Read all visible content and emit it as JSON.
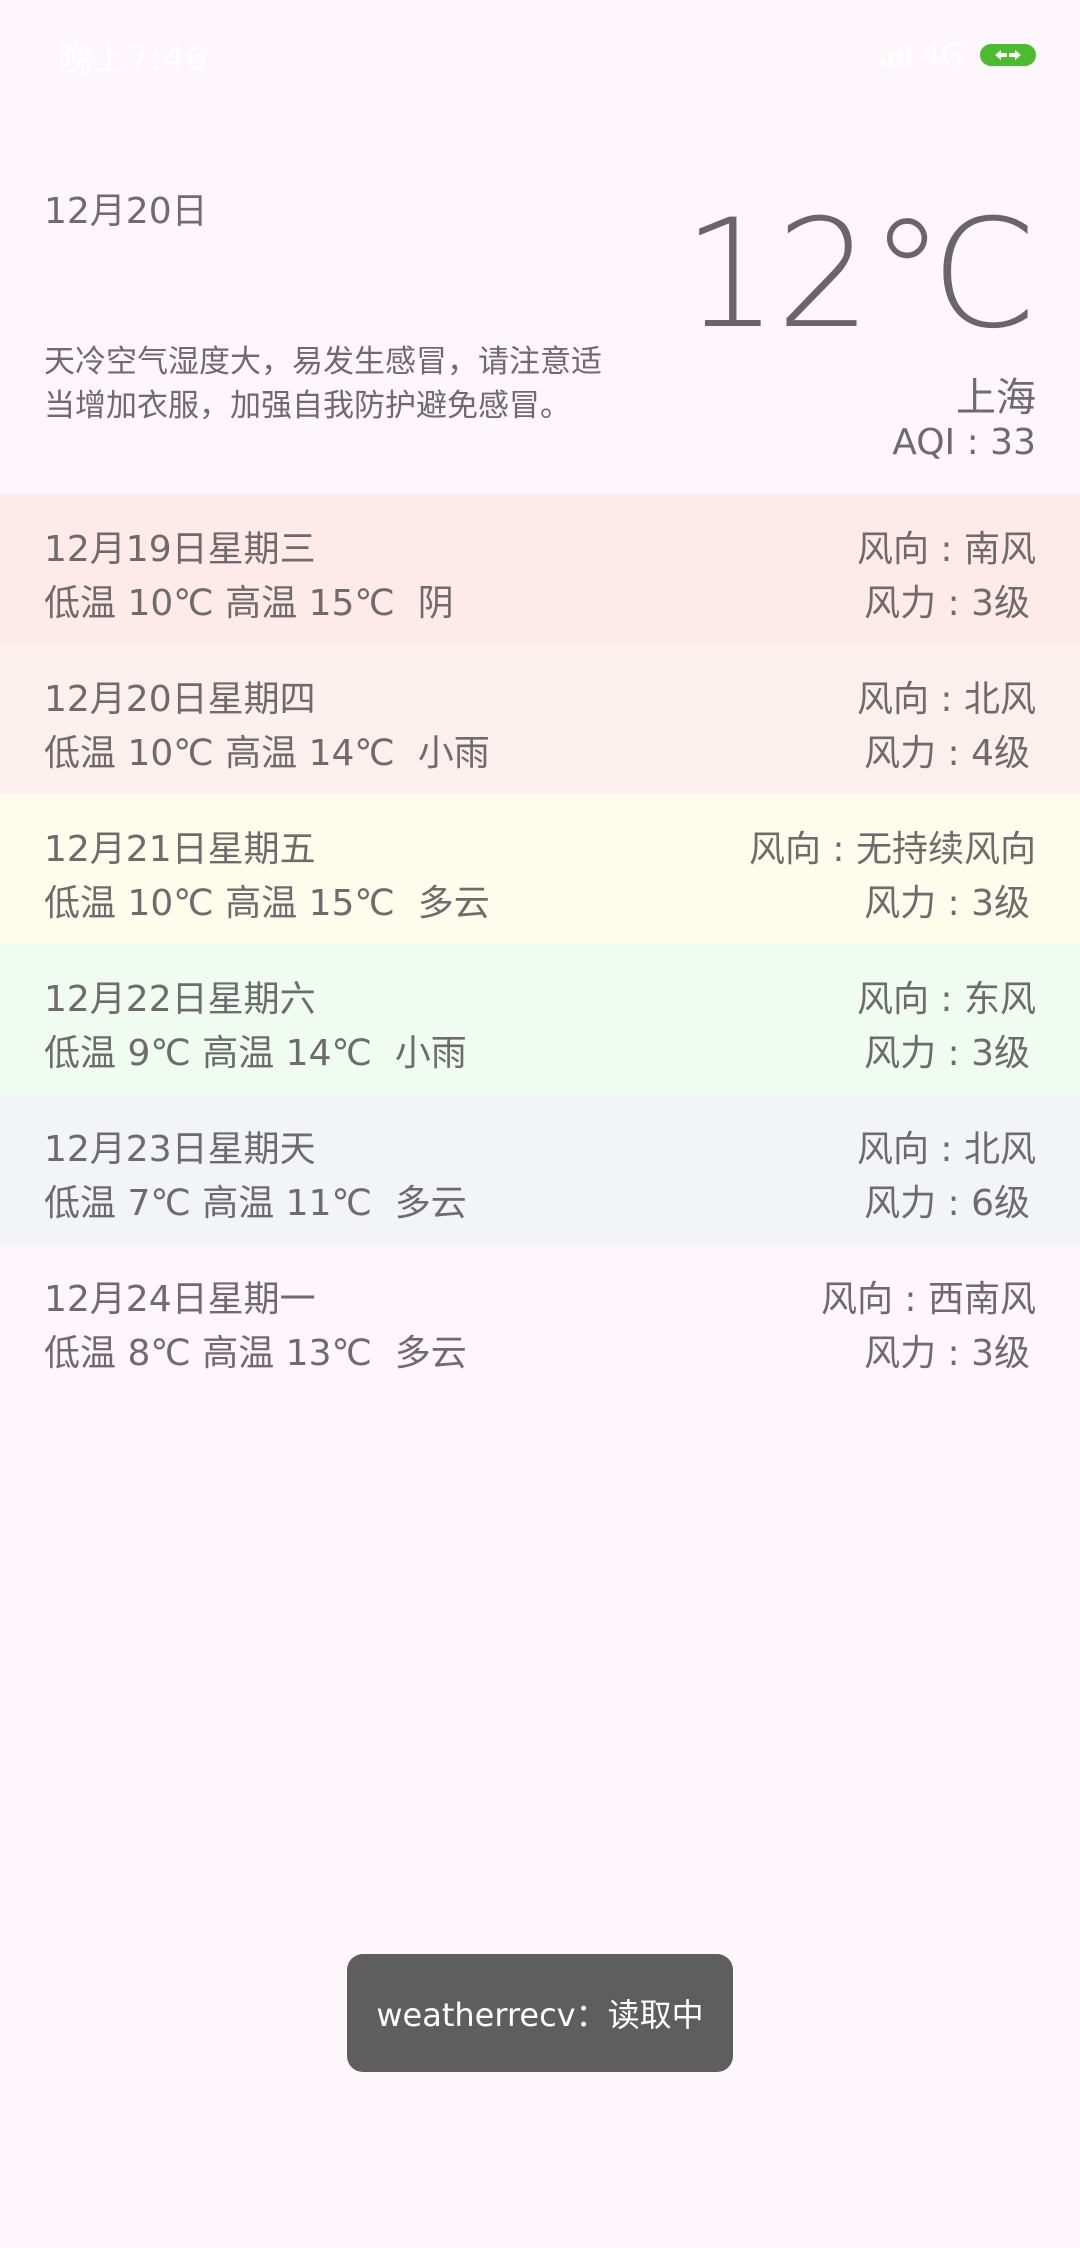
{
  "status_bar": {
    "time": "晚上7:46",
    "network": "4G",
    "battery_color": "#4cbc2e"
  },
  "header": {
    "date": "12月20日",
    "tip": "天冷空气湿度大，易发生感冒，请注意适当增加衣服，加强自我防护避免感冒。",
    "temperature": "12℃",
    "city": "上海",
    "aqi": "AQI : 33"
  },
  "forecast": [
    {
      "date": "12月19日星期三",
      "temps": "低温 10℃ 高温 15℃  阴",
      "wind_dir": "风向 : 南风",
      "wind_power": "风力 : 3级",
      "bg": "#fdeae9"
    },
    {
      "date": "12月20日星期四",
      "temps": "低温 10℃ 高温 14℃  小雨",
      "wind_dir": "风向 : 北风",
      "wind_power": "风力 : 4级",
      "bg": "#fcf0ee"
    },
    {
      "date": "12月21日星期五",
      "temps": "低温 10℃ 高温 15℃  多云",
      "wind_dir": "风向 : 无持续风向",
      "wind_power": "风力 : 3级",
      "bg": "#fdfdec"
    },
    {
      "date": "12月22日星期六",
      "temps": "低温 9℃ 高温 14℃  小雨",
      "wind_dir": "风向 : 东风",
      "wind_power": "风力 : 3级",
      "bg": "#f0fcf1"
    },
    {
      "date": "12月23日星期天",
      "temps": "低温 7℃ 高温 11℃  多云",
      "wind_dir": "风向 : 北风",
      "wind_power": "风力 : 6级",
      "bg": "#f2f4f8"
    },
    {
      "date": "12月24日星期一",
      "temps": "低温 8℃ 高温 13℃  多云",
      "wind_dir": "风向 : 西南风",
      "wind_power": "风力 : 3级",
      "bg": "#fdf7fd"
    }
  ],
  "toast": {
    "message": "weatherrecv：读取中"
  }
}
